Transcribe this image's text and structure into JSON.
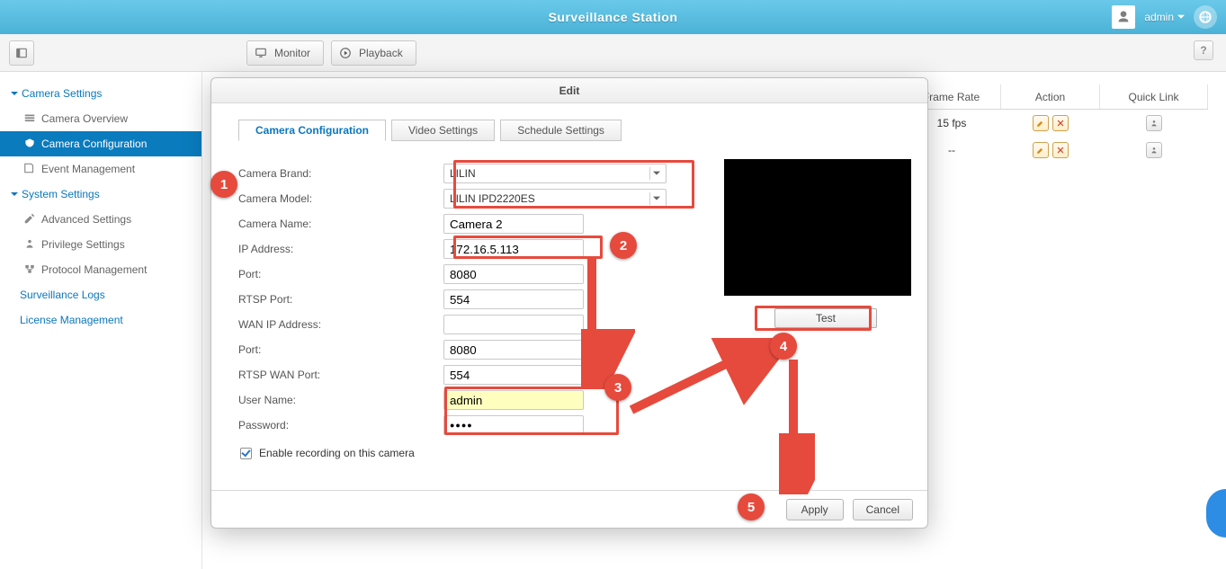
{
  "topbar": {
    "title": "Surveillance Station",
    "user": "admin"
  },
  "toolbar": {
    "monitor": "Monitor",
    "playback": "Playback",
    "help": "?"
  },
  "sidebar": {
    "grp_cam": "Camera Settings",
    "cam_overview": "Camera Overview",
    "cam_config": "Camera Configuration",
    "event_mgmt": "Event Management",
    "grp_sys": "System Settings",
    "adv": "Advanced Settings",
    "priv": "Privilege Settings",
    "proto": "Protocol Management",
    "surv_logs": "Surveillance Logs",
    "license": "License Management"
  },
  "grid": {
    "head_frate": "Frame Rate",
    "head_action": "Action",
    "head_quick": "Quick Link",
    "rows": [
      {
        "frate": "15 fps"
      },
      {
        "frate": "--"
      }
    ]
  },
  "dialog": {
    "title": "Edit",
    "tabs": {
      "config": "Camera Configuration",
      "video": "Video Settings",
      "schedule": "Schedule Settings"
    },
    "labels": {
      "brand": "Camera Brand:",
      "model": "Camera Model:",
      "name": "Camera Name:",
      "ip": "IP Address:",
      "port": "Port:",
      "rtsp": "RTSP Port:",
      "wanip": "WAN IP Address:",
      "wanport": "Port:",
      "rtspwan": "RTSP WAN Port:",
      "user": "User Name:",
      "pass": "Password:",
      "enable": "Enable recording on this camera"
    },
    "values": {
      "brand": "LILIN",
      "model": "LILIN IPD2220ES",
      "name": "Camera 2",
      "ip": "172.16.5.113",
      "port": "8080",
      "rtsp": "554",
      "wanip": "",
      "wanport": "8080",
      "rtspwan": "554",
      "user": "admin",
      "pass": "●●●●"
    },
    "test": "Test",
    "apply": "Apply",
    "cancel": "Cancel"
  },
  "annotations": {
    "b1": "1",
    "b2": "2",
    "b3": "3",
    "b4": "4",
    "b5": "5"
  }
}
